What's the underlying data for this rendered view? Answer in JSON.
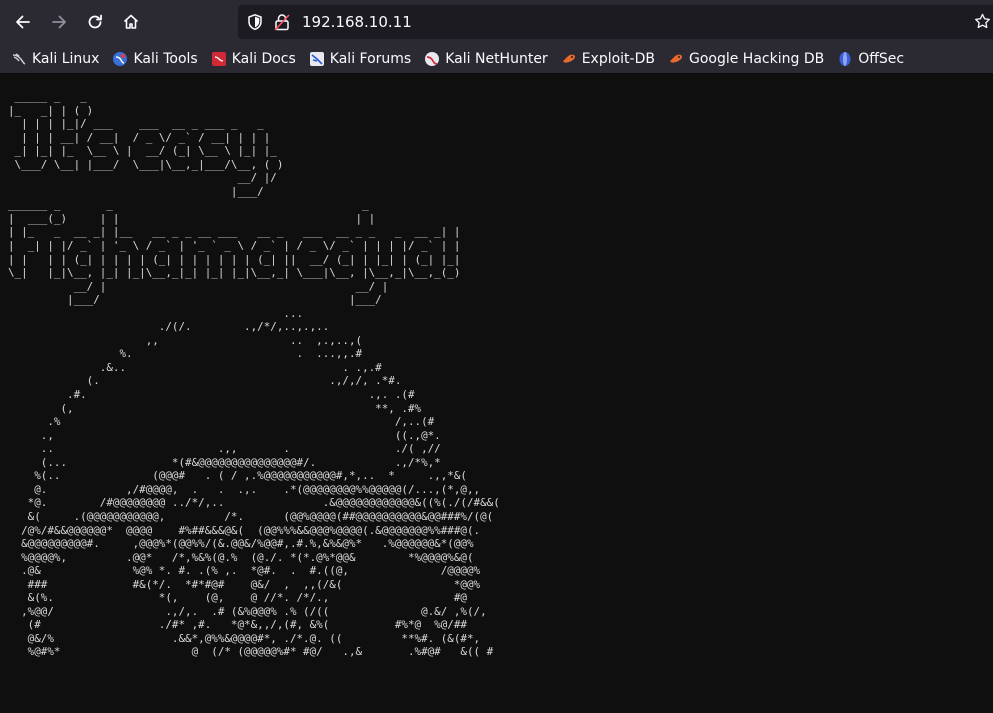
{
  "browser": {
    "url": "192.168.10.11",
    "nav_icons": [
      "back-arrow-icon",
      "forward-arrow-icon",
      "reload-icon",
      "home-icon"
    ],
    "bookmarks": [
      {
        "label": "Kali Linux",
        "icon": "kali-dragon-icon"
      },
      {
        "label": "Kali Tools",
        "icon": "kali-tools-icon"
      },
      {
        "label": "Kali Docs",
        "icon": "kali-docs-icon"
      },
      {
        "label": "Kali Forums",
        "icon": "kali-forums-icon"
      },
      {
        "label": "Kali NetHunter",
        "icon": "kali-nethunter-icon"
      },
      {
        "label": "Exploit-DB",
        "icon": "exploit-db-icon"
      },
      {
        "label": "Google Hacking DB",
        "icon": "google-hacking-db-icon"
      },
      {
        "label": "OffSec",
        "icon": "offsec-icon"
      }
    ]
  },
  "page": {
    "ascii_art": " _____ _   _\n|_   _| | ( )\n  | | | |_|/ ___    ___  __ _ ___ _   _\n  | | | __| / __|  / _ \\/ _` / __| | | |\n _| |_| |_  \\__ \\ |  __/ (_| \\__ \\ |_| |_\n \\___/ \\__| |___/  \\___|\\__,_|___/\\__, ( )\n                                   __/ |/\n                                  |___/\n______ _       _                                      _\n|  ___(_)     | |                                    | |\n| |_   _  __ _| |__   __ _ _ __ ___   __ _   ___  __ _ _   _  __ _| |\n|  _| | |/ _` | '_ \\ / _` | '_ ` _ \\ / _` | / _ \\/ _` | | | |/ _` | |\n| |   | | (_| | | | | (_| | | | | | | (_| ||  __/ (_| | |_| | (_| |_|\n\\_|   |_|\\__, |_| |_|\\__,_|_| |_| |_|\\__,_| \\___|\\__, |\\__,_|\\__,_(_)\n          __/ |                                      __/ |\n         |___/                                      |___/\n                                          ...\n                       ./(/.        .,/*/,..,.,..\n                     ,,                    ..  ,.,..,(\n                 %.                         .  ...,,.#\n              .&..                                 . .,.#\n            (.                                   .,/,/, .*#.\n         .#.                                           .,. .(#\n        (,                                              **, .#%\n      .%                                                   /,..(#\n     .,                                                    ((.,@*.\n     ..                         .,,       .                ./( ,//\n     (...                *(#&@@@@@@@@@@@@@@@#/.            .,/*%,*\n    %(..              (@@@#   . ( / ,.%@@@@@@@@@@@#,*,..  *     .,,*&(\n    @.            ,/#@@@@,  .   .  .,.    .*(@@@@@@@@%%@@@@@(/...,(*,@,,\n   *@.        /#@@@@@@@@ ../*/,..               .&@@@@@@@@@@@@&((%(./(/#&&(\n   &(     .(@@@@@@@@@@@,         /*.      (@@%@@@@(##@@@@@@@@@@&@@###%/(@(\n  /@%/#&&@@@@@@*  @@@@    #%##&&&@&(  (@@%%%&&@@@%@@@@(.&@@@@@@@%%###@(.\n  &@@@@@@@@@#.     ,@@@%*(@@%%/(&.@@&/%@@#,.#.%,&%&@%*   .%@@@@@@&*(@@%\n  %@@@@%,         .@@*   /*,%&%(@.%  (@./. *(*.@%*@@&        *%@@@@%&@(\n  .@&              %@% *. #. .(% ,.  *@#.  .  #.((@,              /@@@@%\n   ###             #&(*/.  *#*#@#    @&/  ,  ,,(/&(                 *@@%\n   &(%.                *(,    (@,    @ //*. /*/.,                   #@\n  ,%@@/                 .,/,.  .# (&%@@@% .% (/((              @.&/ ,%(/,\n   (#                  ./#* ,#.   *@*&,,/,(#, &%(          #%*@  %@/##\n   @&/%                  .&&*,@%%&@@@@#*, ./*.@. ((         **%#. (&(#*,\n   %@#%*                    @  (/* (@@@@@%#* #@/   .,&       .%#@#   &(( #"
  }
}
